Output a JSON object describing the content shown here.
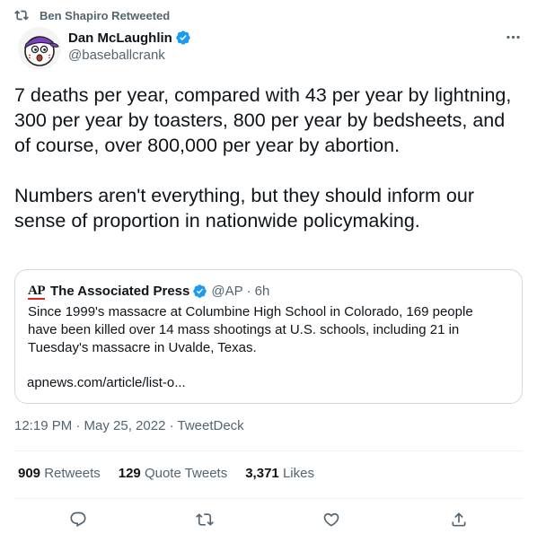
{
  "retweet_header": {
    "text": "Ben Shapiro Retweeted",
    "icon": "retweet-icon"
  },
  "author": {
    "name": "Dan McLaughlin",
    "handle": "@baseballcrank",
    "verified": true,
    "avatar": "baseball-cartoon-avatar"
  },
  "menu_icon": "more-icon",
  "tweet": {
    "paragraphs": [
      "7 deaths per year, compared with 43 per year by lightning, 300 per year by toasters, 800 per year by bedsheets, and of course, over 800,000 per year by abortion.",
      "Numbers aren't everything, but they should inform our sense of proportion in nationwide policymaking."
    ]
  },
  "quote": {
    "logo_text": "AP",
    "name": "The Associated Press",
    "verified": true,
    "handle": "@AP",
    "separator": "·",
    "time": "6h",
    "text": "Since 1999's massacre at Columbine High School in Colorado, 169 people have been killed over 14 mass shootings at U.S. schools, including 21 in Tuesday's massacre in Uvalde, Texas.",
    "link": "apnews.com/article/list-o..."
  },
  "timestamp": "12:19 PM · May 25, 2022 · TweetDeck",
  "stats": {
    "retweets_count": "909",
    "retweets_label": "Retweets",
    "quotes_count": "129",
    "quotes_label": "Quote Tweets",
    "likes_count": "3,371",
    "likes_label": "Likes"
  },
  "actions": [
    "reply-icon",
    "retweet-icon",
    "like-icon",
    "share-icon"
  ],
  "colors": {
    "text_primary": "#0f1419",
    "text_secondary": "#536471",
    "border": "#cfd9de",
    "verified_blue": "#1d9bf0",
    "ap_red": "#e4251b"
  }
}
